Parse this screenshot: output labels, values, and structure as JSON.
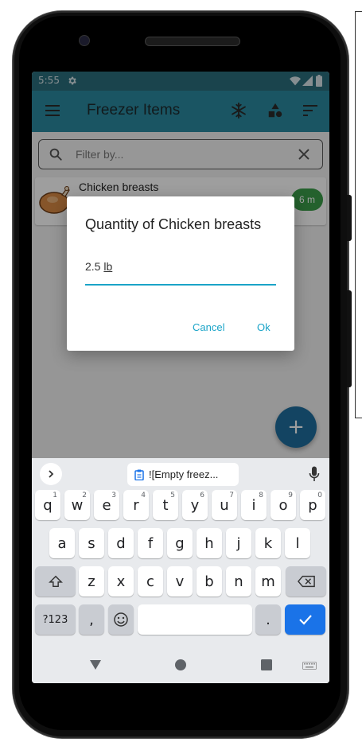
{
  "status_bar": {
    "time": "5:55"
  },
  "app_bar": {
    "title": "Freezer Items"
  },
  "search": {
    "placeholder": "Filter by..."
  },
  "list": {
    "items": [
      {
        "name": "Chicken breasts",
        "age_badge": "6 m"
      }
    ]
  },
  "dialog": {
    "title": "Quantity of Chicken breasts",
    "input_number": "2.5",
    "input_unit": "lb",
    "cancel_label": "Cancel",
    "ok_label": "Ok"
  },
  "fab": {
    "label": "+"
  },
  "keyboard": {
    "suggestion": "![Empty freez...",
    "row1": [
      {
        "key": "q",
        "hint": "1"
      },
      {
        "key": "w",
        "hint": "2"
      },
      {
        "key": "e",
        "hint": "3"
      },
      {
        "key": "r",
        "hint": "4"
      },
      {
        "key": "t",
        "hint": "5"
      },
      {
        "key": "y",
        "hint": "6"
      },
      {
        "key": "u",
        "hint": "7"
      },
      {
        "key": "i",
        "hint": "8"
      },
      {
        "key": "o",
        "hint": "9"
      },
      {
        "key": "p",
        "hint": "0"
      }
    ],
    "row2": [
      "a",
      "s",
      "d",
      "f",
      "g",
      "h",
      "j",
      "k",
      "l"
    ],
    "row3": [
      "z",
      "x",
      "c",
      "v",
      "b",
      "n",
      "m"
    ],
    "symbols_label": "?123",
    "comma_label": ",",
    "period_label": "."
  },
  "colors": {
    "app_bar": "#2a8aa0",
    "status_bar": "#2a6f7d",
    "accent": "#1aa4c8",
    "fab": "#1f6f9e",
    "enter_key": "#1a73e8",
    "badge": "#3a9d49"
  }
}
